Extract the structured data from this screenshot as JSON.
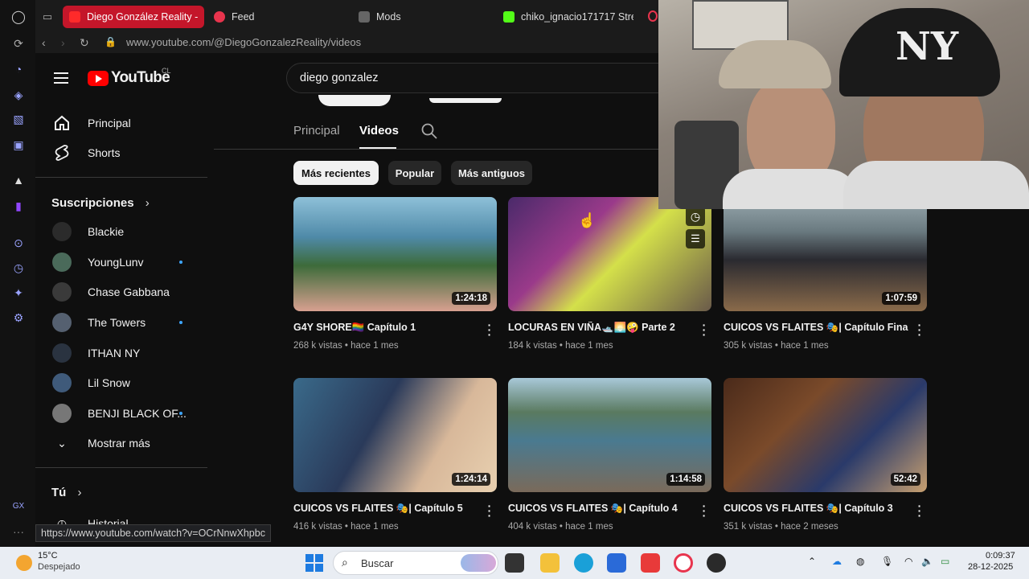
{
  "browser": {
    "tabs": [
      {
        "label": "Diego González Reality -",
        "active": true,
        "icon": "youtube-icon"
      },
      {
        "label": "Feed",
        "active": false,
        "icon": "feed-icon"
      },
      {
        "label": "Mods",
        "active": false,
        "icon": "mods-icon"
      },
      {
        "label": "chiko_ignacio171717 Stre",
        "active": false,
        "icon": "kick-icon"
      }
    ],
    "url": "www.youtube.com/@DiegoGonzalezReality/videos",
    "status_url": "https://www.youtube.com/watch?v=OCrNnwXhpbc"
  },
  "youtube": {
    "logo_text": "YouTube",
    "region": "CL",
    "search_value": "diego gonzalez"
  },
  "guide": {
    "main_items": [
      {
        "label": "Principal",
        "icon": "home-icon"
      },
      {
        "label": "Shorts",
        "icon": "shorts-icon"
      }
    ],
    "subscriptions_title": "Suscripciones",
    "subscriptions": [
      {
        "label": "Blackie",
        "live": false,
        "color": "#2b2b2b"
      },
      {
        "label": "YoungLunv",
        "live": true,
        "color": "#4a6a5a"
      },
      {
        "label": "Chase Gabbana",
        "live": false,
        "color": "#3a3a3a"
      },
      {
        "label": "The Towers",
        "live": true,
        "color": "#556070"
      },
      {
        "label": "ITHAN NY",
        "live": false,
        "color": "#2a3340"
      },
      {
        "label": "Lil Snow",
        "live": false,
        "color": "#3f5a7a"
      },
      {
        "label": "BENJI BLACK OF...",
        "live": true,
        "color": "#777777"
      }
    ],
    "show_more": "Mostrar más",
    "you_title": "Tú",
    "history": "Historial"
  },
  "channel": {
    "tabs": [
      "Principal",
      "Videos"
    ],
    "selected_tab": "Videos",
    "chips": [
      "Más recientes",
      "Popular",
      "Más antiguos"
    ],
    "selected_chip": "Más recientes"
  },
  "videos": [
    {
      "title": "G4Y SHORE🏳️‍🌈 Capítulo 1",
      "meta": "268 k vistas • hace 1 mes",
      "duration": "1:24:18",
      "colors": [
        "#5b8fa0",
        "#3d6b3a"
      ]
    },
    {
      "title": "LOCURAS EN VIÑA🛥️🌅🤪 Parte 2",
      "meta": "184 k vistas • hace 1 mes",
      "duration": "",
      "colors": [
        "#6a2c7a",
        "#c9d84a"
      ]
    },
    {
      "title": "CUICOS VS FLAITES 🎭| Capítulo Final",
      "meta": "305 k vistas • hace 1 mes",
      "duration": "1:07:59",
      "colors": [
        "#8a9aa0",
        "#4a3a2a"
      ]
    },
    {
      "title": "CUICOS VS FLAITES 🎭| Capítulo 5",
      "meta": "416 k vistas • hace 1 mes",
      "duration": "1:24:14",
      "colors": [
        "#3a6a8a",
        "#d8b89a"
      ]
    },
    {
      "title": "CUICOS VS FLAITES 🎭| Capítulo 4",
      "meta": "404 k vistas • hace 1 mes",
      "duration": "1:14:58",
      "colors": [
        "#7a9ab0",
        "#3a4a3a"
      ]
    },
    {
      "title": "CUICOS VS FLAITES 🎭| Capítulo 3",
      "meta": "351 k vistas • hace 2 meses",
      "duration": "52:42",
      "colors": [
        "#5a3a2a",
        "#2a3a6a"
      ]
    }
  ],
  "taskbar": {
    "weather_temp": "15°C",
    "weather_desc": "Despejado",
    "search_placeholder": "Buscar",
    "time": "0:09:37",
    "date": "28-12-2025"
  }
}
